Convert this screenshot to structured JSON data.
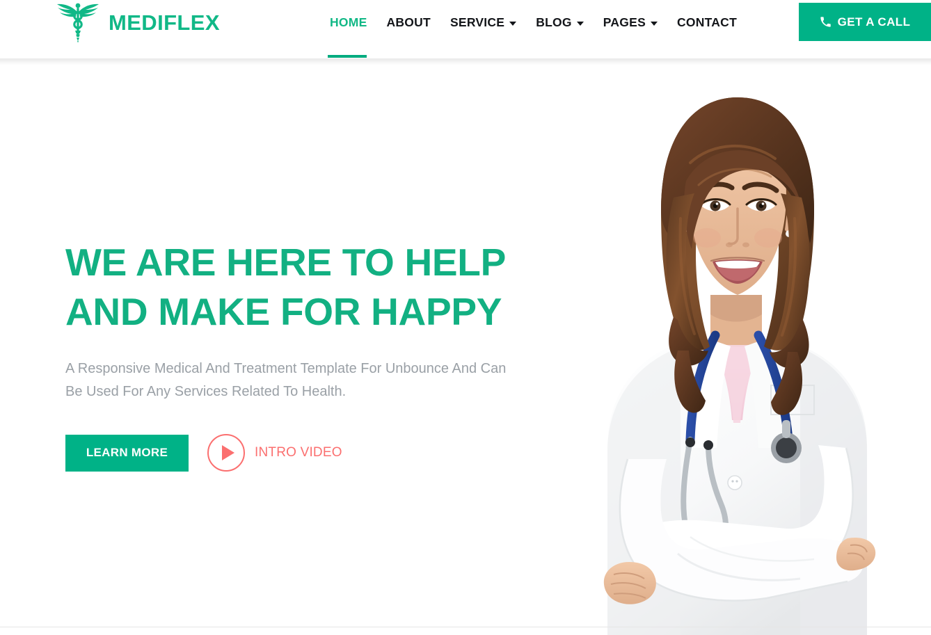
{
  "brand": {
    "name": "MEDIFLEX",
    "logo_icon": "caduceus-icon",
    "accent_color": "#00b287",
    "heading_color": "#12b082",
    "coral_color": "#fb6f6f"
  },
  "header": {
    "nav": [
      {
        "label": "HOME",
        "active": true,
        "has_dropdown": false
      },
      {
        "label": "ABOUT",
        "active": false,
        "has_dropdown": false
      },
      {
        "label": "SERVICE",
        "active": false,
        "has_dropdown": true
      },
      {
        "label": "BLOG",
        "active": false,
        "has_dropdown": true
      },
      {
        "label": "PAGES",
        "active": false,
        "has_dropdown": true
      },
      {
        "label": "CONTACT",
        "active": false,
        "has_dropdown": false
      }
    ],
    "cta": {
      "label": "GET A CALL",
      "icon": "phone-icon"
    }
  },
  "hero": {
    "title_line_1": "WE ARE HERE TO HELP",
    "title_line_2": "AND MAKE FOR HAPPY",
    "subtitle": "A Responsive Medical And Treatment Template For Unbounce And Can Be Used For Any Services Related To Health.",
    "primary_button": "LEARN MORE",
    "video_link": "INTRO VIDEO",
    "video_icon": "play-icon",
    "image_alt": "smiling-female-doctor-with-stethoscope"
  }
}
